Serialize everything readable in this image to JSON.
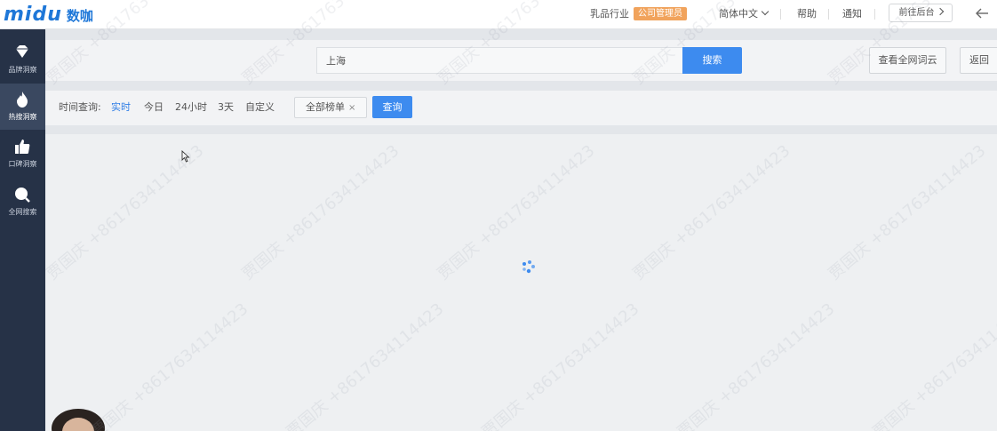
{
  "header": {
    "logo_latin": "midu",
    "logo_cn": "数咖",
    "industry": "乳品行业",
    "company_badge": "公司管理员",
    "language": "简体中文",
    "help": "帮助",
    "notify": "通知",
    "goto_backend": "前往后台"
  },
  "sidebar": {
    "items": [
      {
        "label": "品牌洞察",
        "icon": "diamond-icon"
      },
      {
        "label": "热搜洞察",
        "icon": "flame-icon"
      },
      {
        "label": "口碑洞察",
        "icon": "thumbs-up-icon"
      },
      {
        "label": "全网搜索",
        "icon": "search-icon"
      }
    ]
  },
  "search": {
    "value": "上海",
    "button": "搜索",
    "view_cloud": "查看全网词云",
    "back": "返回"
  },
  "filters": {
    "label": "时间查询:",
    "options": [
      "实时",
      "今日",
      "24小时",
      "3天",
      "自定义"
    ],
    "active": "实时",
    "tag": "全部榜单",
    "tag_close": "×",
    "query_button": "查询"
  },
  "watermark": "贾国庆 +8617634114423",
  "colors": {
    "accent": "#3d8bef",
    "sidebar_bg": "#263247",
    "badge": "#f1a35c"
  }
}
